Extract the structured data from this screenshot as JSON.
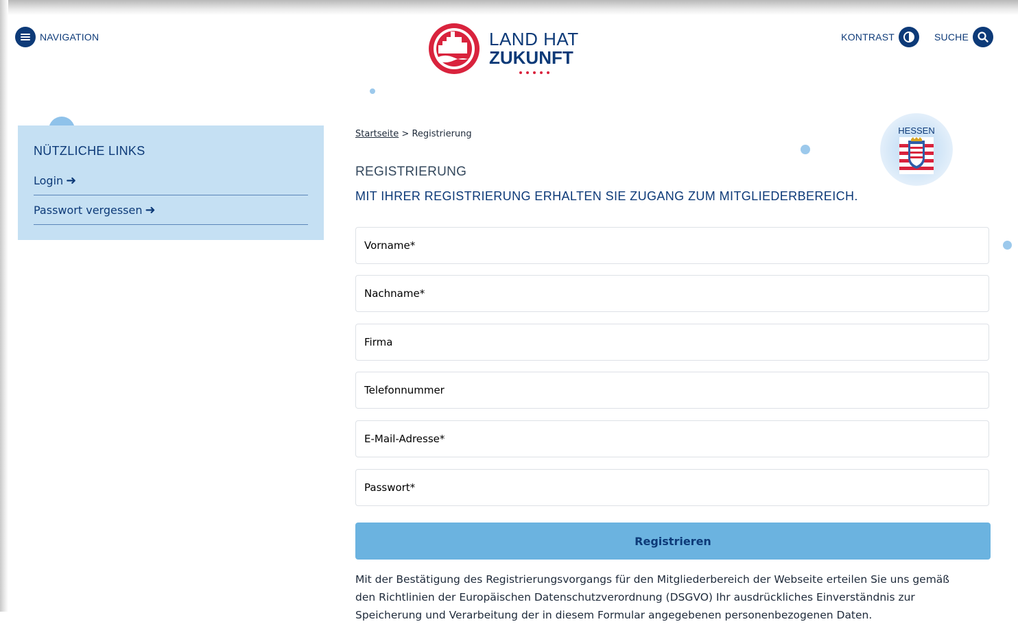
{
  "header": {
    "nav_label": "NAVIGATION",
    "logo_line1": "LAND HAT",
    "logo_line2": "ZUKUNFT",
    "contrast_label": "KONTRAST",
    "search_label": "SUCHE"
  },
  "sidebar": {
    "title": "NÜTZLICHE LINKS",
    "links": [
      {
        "label": "Login"
      },
      {
        "label": "Passwort vergessen"
      }
    ]
  },
  "breadcrumb": {
    "home": "Startseite",
    "separator": ">",
    "current": "Registrierung"
  },
  "hessen_label": "HESSEN",
  "main": {
    "title": "REGISTRIERUNG",
    "subtitle": "MIT IHRER REGISTRIERUNG ERHALTEN SIE ZUGANG ZUM MITGLIEDERBEREICH.",
    "fields": [
      {
        "placeholder": "Vorname*"
      },
      {
        "placeholder": "Nachname*"
      },
      {
        "placeholder": "Firma"
      },
      {
        "placeholder": "Telefonnummer"
      },
      {
        "placeholder": "E-Mail-Adresse*"
      },
      {
        "placeholder": "Passwort*"
      }
    ],
    "submit_label": "Registrieren",
    "notice": "Mit der Bestätigung des Registrierungsvorgangs für den Mitgliederbereich der Webseite erteilen Sie uns gemäß den Richtlinien der Europäischen Datenschutzverordnung (DSGVO) Ihr ausdrückliches Einverständnis zur Speicherung und Verarbeitung der in diesem Formular angegebenen personenbezogenen Daten."
  },
  "colors": {
    "brand_blue": "#0d3a78",
    "brand_red": "#d9233d",
    "sidebar_bg": "#c5e0f3",
    "button_bg": "#6bb3e0"
  }
}
